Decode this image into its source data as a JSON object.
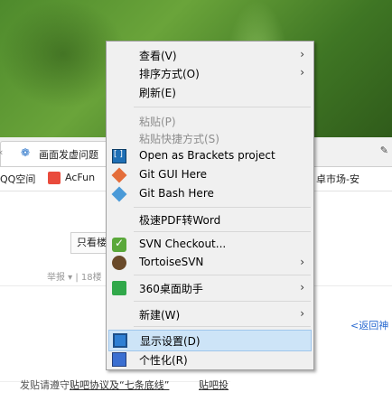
{
  "browser": {
    "tab_title": "画面发虚问题",
    "tab_prev_glyph": "‹",
    "tab_fav_glyph": "❁",
    "pin_glyph": "✎",
    "bookmarks": [
      {
        "label": "QQ空间"
      },
      {
        "label": "AcFun"
      }
    ],
    "bookmark_right": "卓市场-安",
    "only_view": "只看楼",
    "report_text": "举报 ▾ | 18楼",
    "back_link": "<返回神",
    "notice_prefix": "发贴请遵守",
    "notice_link": "贴吧协议及“七条底线”",
    "notice_extra": "贴吧投"
  },
  "context_menu": {
    "items": [
      {
        "label": "查看(V)",
        "submenu": true,
        "disabled": false
      },
      {
        "label": "排序方式(O)",
        "submenu": true,
        "disabled": false
      },
      {
        "label": "刷新(E)",
        "submenu": false,
        "disabled": false
      },
      {
        "label": "粘贴(P)",
        "submenu": false,
        "disabled": true
      },
      {
        "label": "粘贴快捷方式(S)",
        "submenu": false,
        "disabled": true
      },
      {
        "label": "Open as Brackets project",
        "icon": "brackets-icon",
        "submenu": false,
        "disabled": false
      },
      {
        "label": "Git GUI Here",
        "icon": "git-gui-icon",
        "submenu": false,
        "disabled": false
      },
      {
        "label": "Git Bash Here",
        "icon": "git-bash-icon",
        "submenu": false,
        "disabled": false
      },
      {
        "label": "极速PDF转Word",
        "submenu": false,
        "disabled": false
      },
      {
        "label": "SVN Checkout...",
        "icon": "svn-checkout-icon",
        "submenu": false,
        "disabled": false
      },
      {
        "label": "TortoiseSVN",
        "icon": "tortoisesvn-icon",
        "submenu": true,
        "disabled": false
      },
      {
        "label": "360桌面助手",
        "icon": "360-desktop-icon",
        "submenu": true,
        "disabled": false
      },
      {
        "label": "新建(W)",
        "submenu": true,
        "disabled": false
      },
      {
        "label": "显示设置(D)",
        "icon": "display-settings-icon",
        "submenu": false,
        "disabled": false,
        "highlighted": true
      },
      {
        "label": "个性化(R)",
        "icon": "personalize-icon",
        "submenu": false,
        "disabled": false
      }
    ],
    "submenu_glyph": "›"
  }
}
